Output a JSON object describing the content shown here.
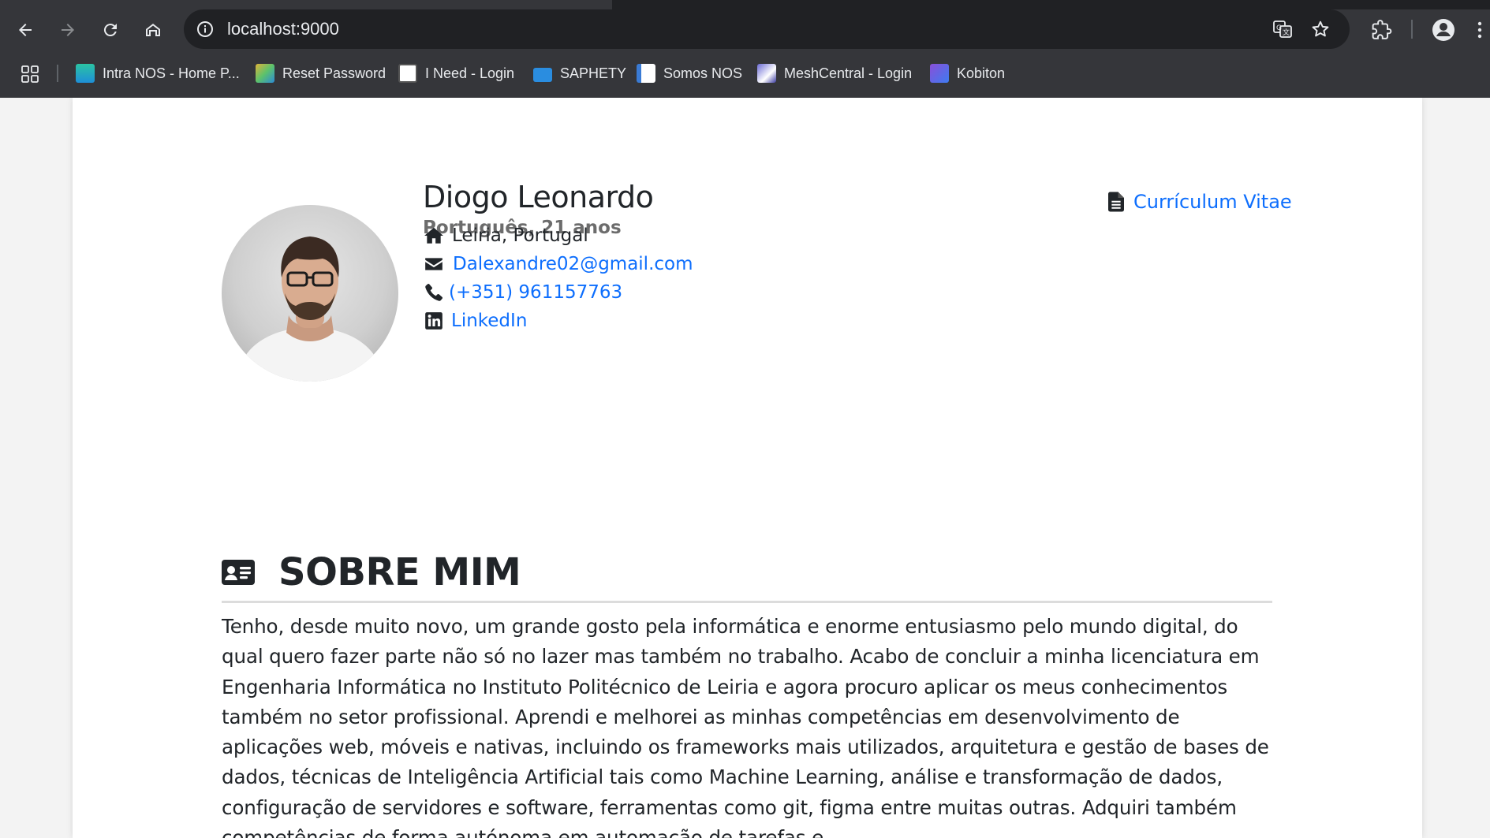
{
  "browser": {
    "url": "localhost:9000",
    "bookmarks": [
      {
        "label": "Intra NOS - Home P...",
        "icon": "intra-nos-icon",
        "color": "#2bc4a3"
      },
      {
        "label": "Reset Password",
        "icon": "reset-password-icon",
        "color": "#e0b33a"
      },
      {
        "label": "I Need - Login",
        "icon": "ineed-icon",
        "color": "#ffffff"
      },
      {
        "label": "SAPHETY",
        "icon": "saphety-icon",
        "color": "#2a8de0"
      },
      {
        "label": "Somos NOS",
        "icon": "somos-nos-icon",
        "color": "#3a7bd5"
      },
      {
        "label": "MeshCentral - Login",
        "icon": "meshcentral-icon",
        "color": "#6b6bd6"
      },
      {
        "label": "Kobiton",
        "icon": "kobiton-icon",
        "color": "#8a4fd8"
      }
    ]
  },
  "profile": {
    "name": "Diogo Leonardo",
    "subtitle": "Português, 21 anos",
    "cv_label": "Currículum Vitae",
    "location": "Leiria, Portugal",
    "email": "Dalexandre02@gmail.com",
    "phone": "(+351) 961157763",
    "linkedin": "LinkedIn"
  },
  "about": {
    "title": "SOBRE MIM",
    "text": "Tenho, desde muito novo, um grande gosto pela informática e enorme entusiasmo pelo mundo digital, do qual quero fazer parte não só no lazer mas também no trabalho. Acabo de concluir a minha licenciatura em Engenharia Informática no Instituto Politécnico de Leiria e agora procuro aplicar os meus conhecimentos também no setor profissional. Aprendi e melhorei as minhas competências em desenvolvimento de aplicações web, móveis e nativas, incluindo os frameworks mais utilizados, arquitetura e gestão de bases de dados, técnicas de Inteligência Artificial tais como Machine Learning, análise e transformação de dados, configuração de servidores e software, ferramentas como git, figma entre muitas outras. Adquiri também competências de forma autónoma em automação de tarefas e"
  },
  "colors": {
    "link": "#0d6efd",
    "text": "#212529",
    "chrome_bg": "#35363a"
  }
}
